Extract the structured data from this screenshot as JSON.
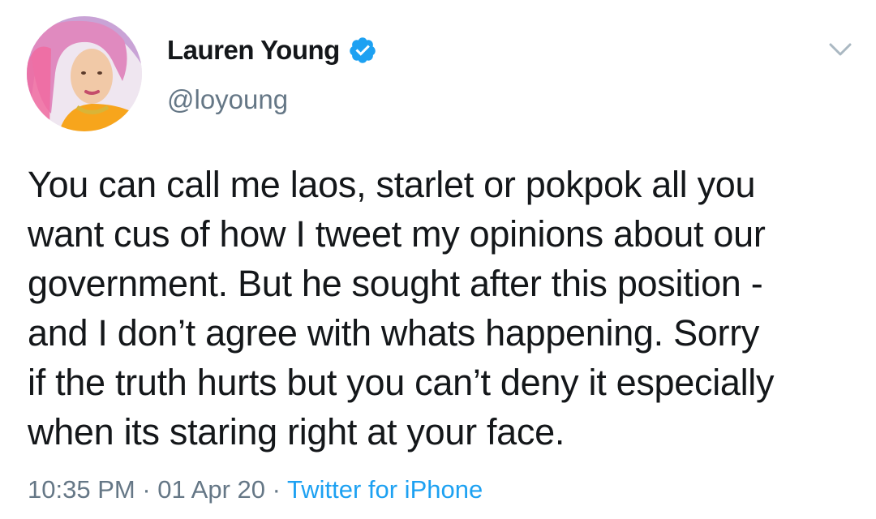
{
  "author": {
    "display_name": "Lauren Young",
    "handle": "@loyoung",
    "verified": true
  },
  "tweet": {
    "lines": [
      "You can call me laos, starlet or pokpok all you",
      "want cus of how I tweet my opinions about our",
      "government. But he sought after this position -",
      "and I don’t agree with whats happening. Sorry",
      "if the truth hurts but you can’t deny it especially",
      "when its staring right at your face."
    ]
  },
  "meta": {
    "time": "10:35 PM",
    "separator": " · ",
    "date": "01 Apr 20",
    "source": "Twitter for iPhone"
  },
  "icons": {
    "verified": "verified-badge-icon",
    "menu": "chevron-down-icon"
  },
  "colors": {
    "text": "#14171a",
    "secondary": "#657786",
    "accent": "#1da1f2",
    "background": "#ffffff"
  }
}
